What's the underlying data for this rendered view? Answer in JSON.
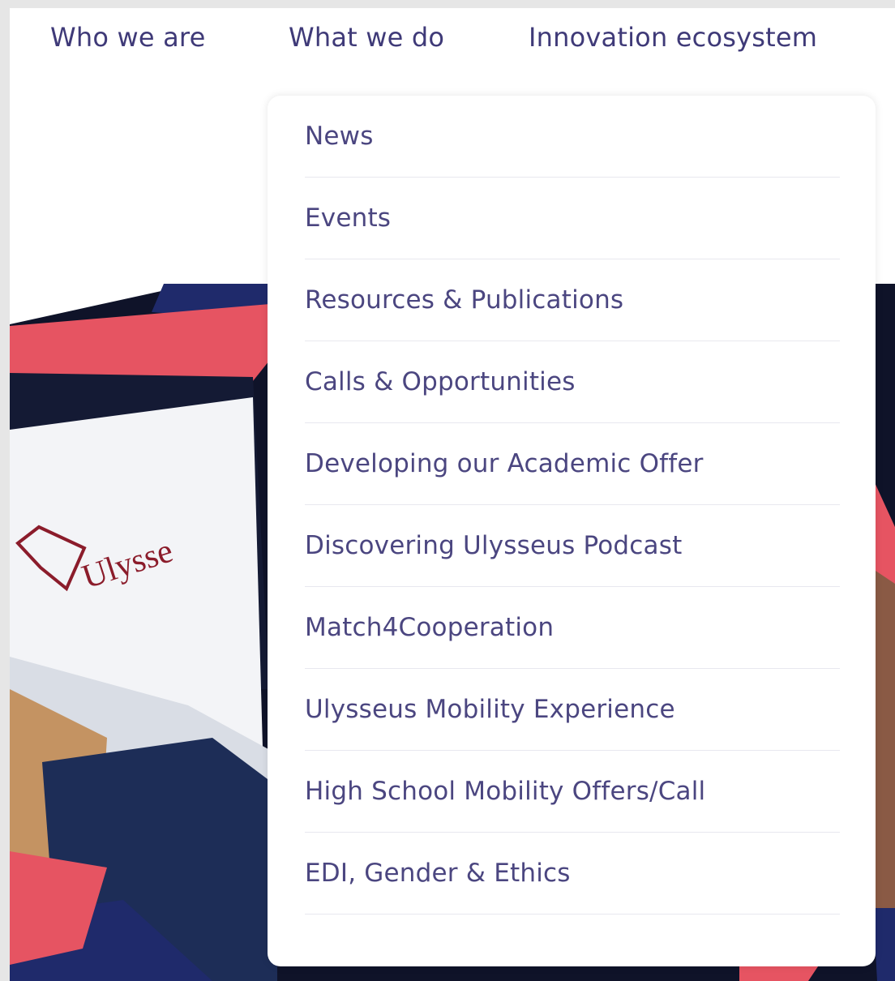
{
  "nav": {
    "items": [
      {
        "label": "Who we are"
      },
      {
        "label": "What we do"
      },
      {
        "label": "Innovation ecosystem"
      }
    ]
  },
  "dropdown": {
    "items": [
      {
        "label": "News"
      },
      {
        "label": "Events"
      },
      {
        "label": "Resources & Publications"
      },
      {
        "label": "Calls & Opportunities"
      },
      {
        "label": "Developing our Academic Offer"
      },
      {
        "label": "Discovering Ulysseus Podcast"
      },
      {
        "label": "Match4Cooperation"
      },
      {
        "label": "Ulysseus Mobility Experience"
      },
      {
        "label": "High School Mobility Offers/Call"
      },
      {
        "label": "EDI, Gender & Ethics"
      }
    ]
  },
  "hero": {
    "logo_text": "Ulysse"
  },
  "colors": {
    "nav_text": "#3f3a78",
    "menu_text": "#4b4680",
    "accent_red": "#e65462",
    "accent_navy": "#1f2a6b"
  }
}
